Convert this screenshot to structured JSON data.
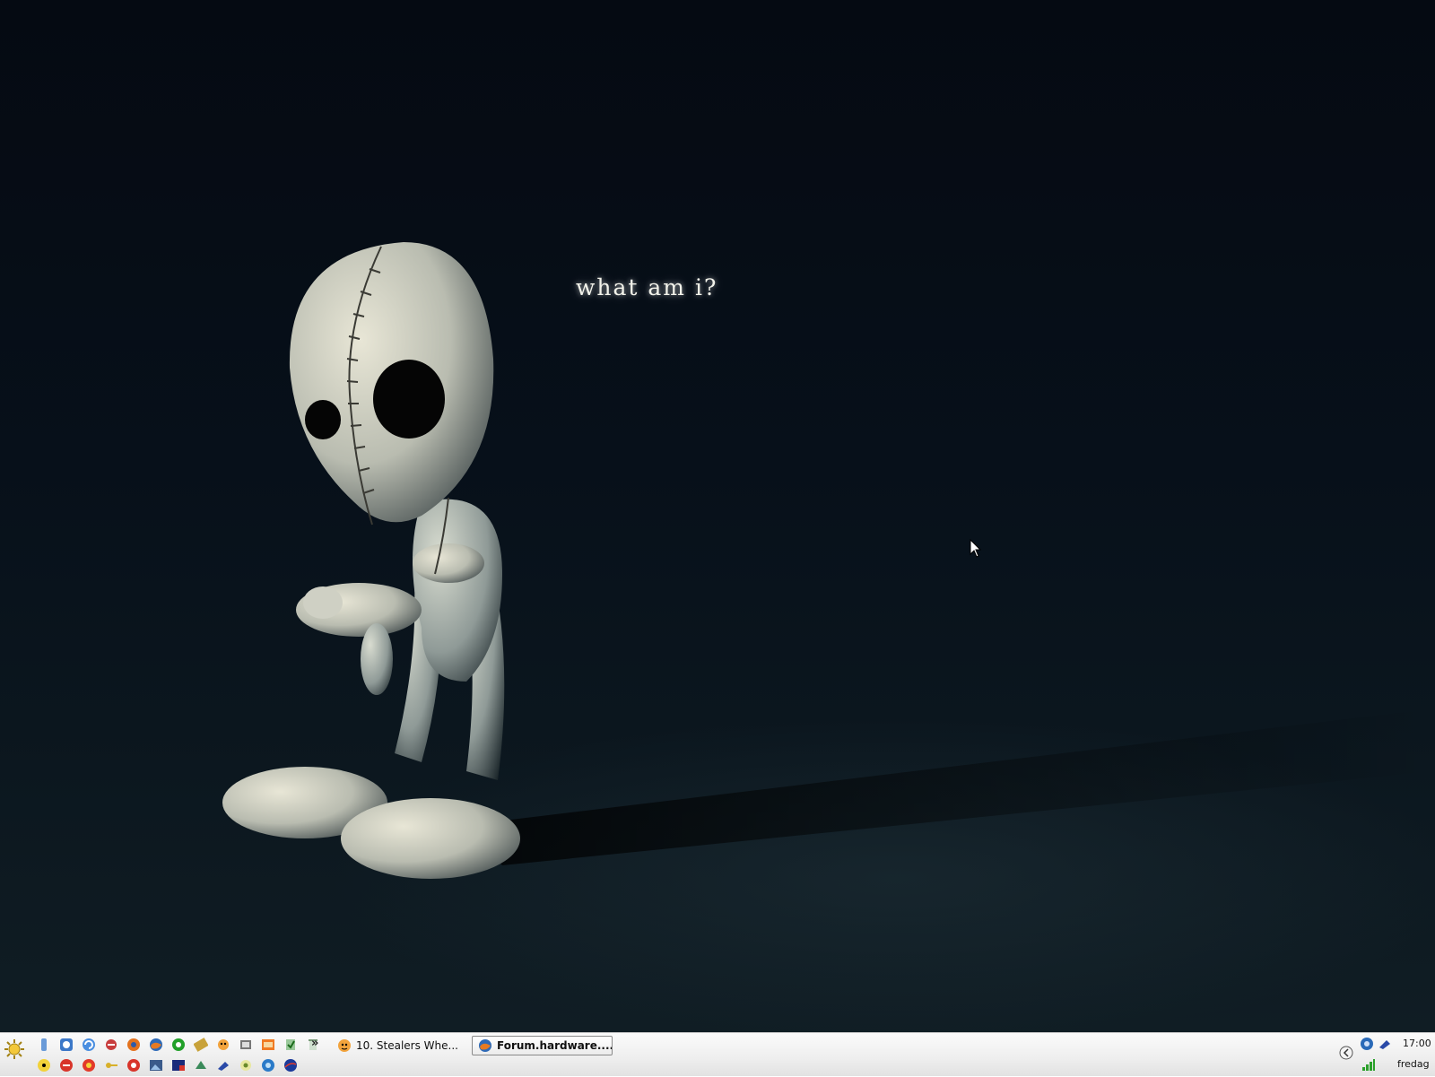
{
  "wallpaper": {
    "caption": "what am i?"
  },
  "taskbar": {
    "quick_launch_row1": [
      "desktop-icon",
      "messenger-icon",
      "refresh-icon",
      "internet-explorer-icon",
      "opera-icon",
      "firefox-icon",
      "thunderbird-icon",
      "green-app-icon",
      "pencil-icon",
      "winamp-icon",
      "calculator-icon",
      "media-icon",
      "recycle-icon"
    ],
    "quick_launch_row2": [
      "radiation-icon",
      "ccleaner-icon",
      "red-circle-icon",
      "key-icon",
      "cdburner-icon",
      "image-icon",
      "tool-icon",
      "network-icon",
      "arrow-icon",
      "eye-icon",
      "spiral-icon",
      "nasa-icon"
    ],
    "more_label": "»",
    "tasks": [
      {
        "label": "10. Stealers Whe...",
        "icon": "music-icon",
        "active": false
      },
      {
        "label": "Forum.hardware....",
        "icon": "firefox-icon",
        "active": true
      }
    ]
  },
  "tray": {
    "time": "17:00",
    "day": "fredag",
    "icons": [
      "collapse-icon",
      "thunderbird-icon",
      "messenger-icon",
      "signal-icon"
    ]
  }
}
